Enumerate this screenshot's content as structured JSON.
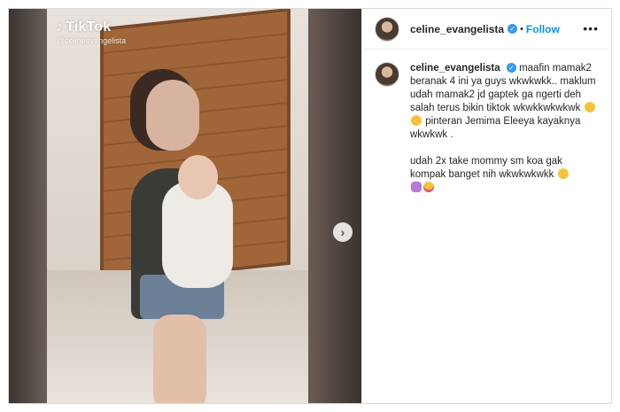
{
  "video": {
    "watermark_brand": "TikTok",
    "watermark_handle": "@celineevangelista"
  },
  "post": {
    "username": "celine_evangelista",
    "follow_label": "Follow",
    "separator": "•",
    "more_label": "•••"
  },
  "caption": {
    "username": "celine_evangelista",
    "text_part1": "maafin mamak2 beranak 4 ini ya guys wkwkwkk.. maklum udah mamak2 jd gaptek ga ngerti deh salah terus bikin tiktok wkwkkwkwkwk",
    "text_part2": "pinteran Jemima Eleeya kayaknya wkwkwk .",
    "text_part3": "udah 2x take mommy sm koa gak kompak banget nih wkwkwkwkk"
  },
  "icons": {
    "verified": "verified-badge-icon",
    "next": "chevron-right-icon",
    "emoji_laugh": "rolling-laughing-emoji",
    "emoji_smile": "grinning-emoji",
    "emoji_person": "woman-gesturing-emoji",
    "emoji_tongue": "tongue-face-emoji"
  },
  "colors": {
    "link_blue": "#0095f6",
    "verified_blue": "#3897f0"
  }
}
